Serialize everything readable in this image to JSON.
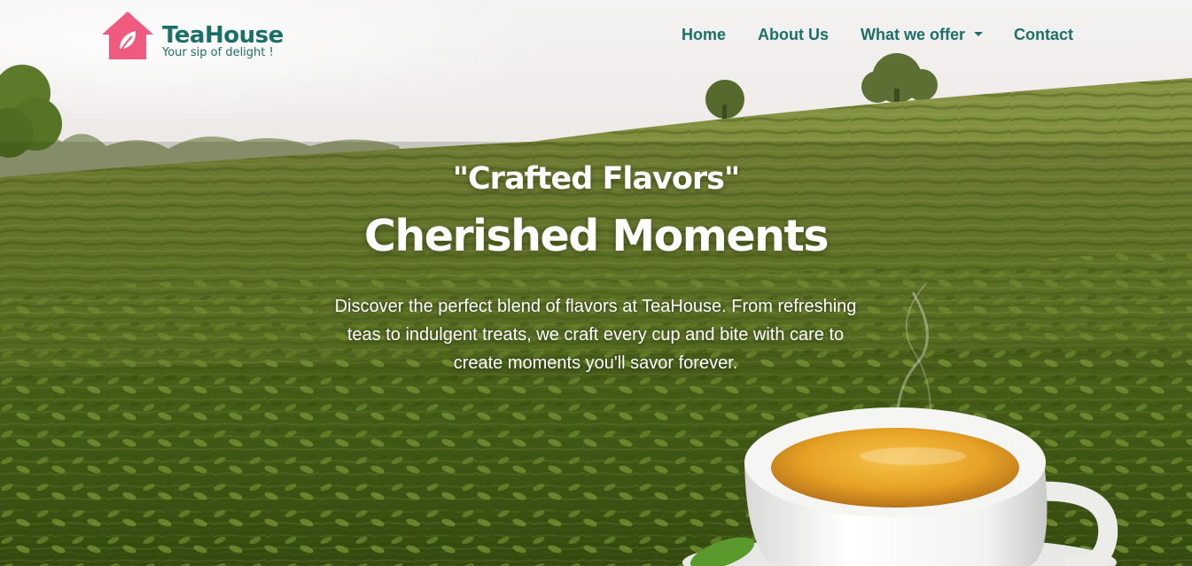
{
  "brand": {
    "name": "TeaHouse",
    "tagline": "Your sip of delight !",
    "logo_icon": "house-leaf-icon",
    "logo_color": "#f05a7e"
  },
  "nav": {
    "items": [
      {
        "label": "Home"
      },
      {
        "label": "About Us"
      },
      {
        "label": "What we offer",
        "icon": "caret-down-icon"
      },
      {
        "label": "Contact"
      }
    ]
  },
  "hero": {
    "subtitle": "\"Crafted Flavors\"",
    "title": "Cherished Moments",
    "description": "Discover the perfect blend of flavors at TeaHouse. From refreshing teas to indulgent treats, we craft every cup and bite with care to create moments you'll savor forever."
  },
  "colors": {
    "accent": "#1b6f69",
    "heading_text": "#ffffff"
  }
}
